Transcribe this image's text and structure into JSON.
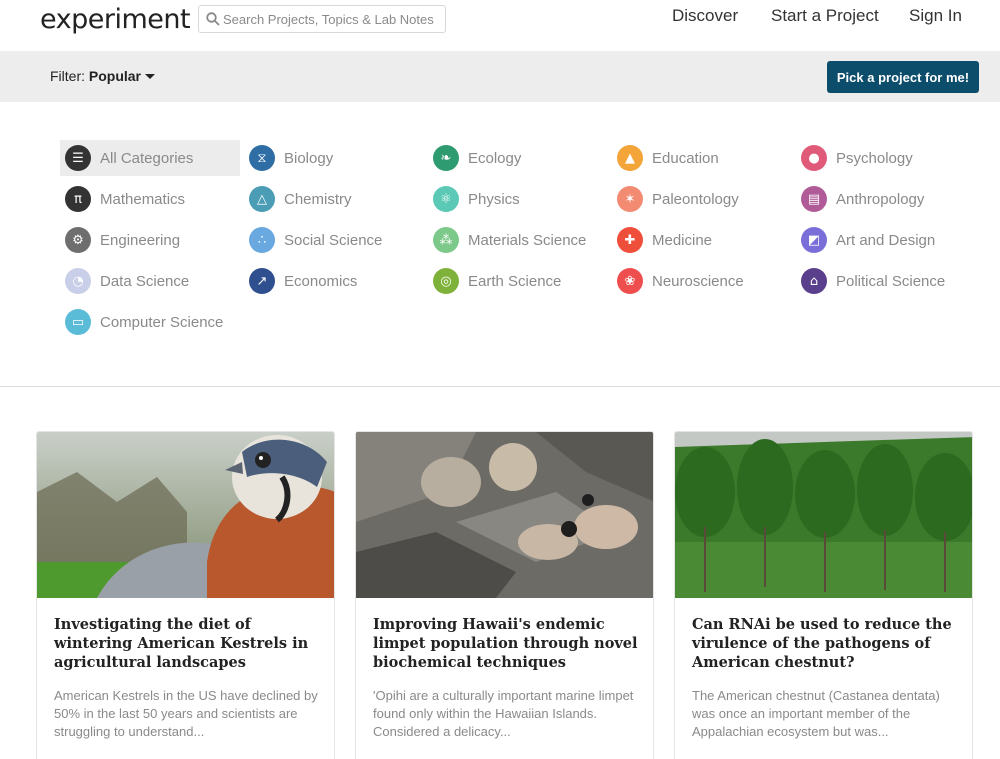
{
  "header": {
    "logo": "experiment",
    "search_placeholder": "Search Projects, Topics & Lab Notes",
    "nav": [
      "Discover",
      "Start a Project",
      "Sign In"
    ]
  },
  "filterbar": {
    "filter_label": "Filter:",
    "filter_value": "Popular",
    "pick_button": "Pick a project for me!"
  },
  "categories": [
    {
      "label": "All Categories",
      "icon": "list-icon",
      "color": "#333333"
    },
    {
      "label": "Biology",
      "icon": "dna-icon",
      "color": "#2f6ea5"
    },
    {
      "label": "Ecology",
      "icon": "leaf-icon",
      "color": "#2f9b70"
    },
    {
      "label": "Education",
      "icon": "graduation-cap-icon",
      "color": "#f3a53a"
    },
    {
      "label": "Psychology",
      "icon": "head-icon",
      "color": "#e05a7a"
    },
    {
      "label": "Mathematics",
      "icon": "pi-icon",
      "color": "#333333"
    },
    {
      "label": "Chemistry",
      "icon": "flask-icon",
      "color": "#4a9db5"
    },
    {
      "label": "Physics",
      "icon": "atom-icon",
      "color": "#5bc9b5"
    },
    {
      "label": "Paleontology",
      "icon": "dinosaur-icon",
      "color": "#f28b72"
    },
    {
      "label": "Anthropology",
      "icon": "book-icon",
      "color": "#b05b98"
    },
    {
      "label": "Engineering",
      "icon": "gear-icon",
      "color": "#6e6e6e"
    },
    {
      "label": "Social Science",
      "icon": "network-icon",
      "color": "#6aa8e0"
    },
    {
      "label": "Materials Science",
      "icon": "molecule-icon",
      "color": "#7dc98a"
    },
    {
      "label": "Medicine",
      "icon": "cross-icon",
      "color": "#ee4e3a"
    },
    {
      "label": "Art and Design",
      "icon": "palette-icon",
      "color": "#7a6fd8"
    },
    {
      "label": "Data Science",
      "icon": "pie-chart-icon",
      "color": "#c9cfe8"
    },
    {
      "label": "Economics",
      "icon": "chart-icon",
      "color": "#2f4f8f"
    },
    {
      "label": "Earth Science",
      "icon": "globe-icon",
      "color": "#7fb23a"
    },
    {
      "label": "Neuroscience",
      "icon": "brain-icon",
      "color": "#ee4e4e"
    },
    {
      "label": "Political Science",
      "icon": "building-icon",
      "color": "#5a3f8c"
    },
    {
      "label": "Computer Science",
      "icon": "monitor-icon",
      "color": "#5bbcd8"
    }
  ],
  "projects": [
    {
      "title": "Investigating the diet of wintering American Kestrels in agricultural landscapes",
      "description": "American Kestrels in the US have declined by 50% in the last 50 years and scientists are struggling to understand..."
    },
    {
      "title": "Improving Hawaii's endemic limpet population through novel biochemical techniques",
      "description": "'Opihi are a culturally important marine limpet found only within the Hawaiian Islands. Considered a delicacy..."
    },
    {
      "title": "Can RNAi be used to reduce the virulence of the pathogens of American chestnut?",
      "description": "The American chestnut (Castanea dentata) was once an important member of the Appalachian ecosystem but was..."
    }
  ]
}
